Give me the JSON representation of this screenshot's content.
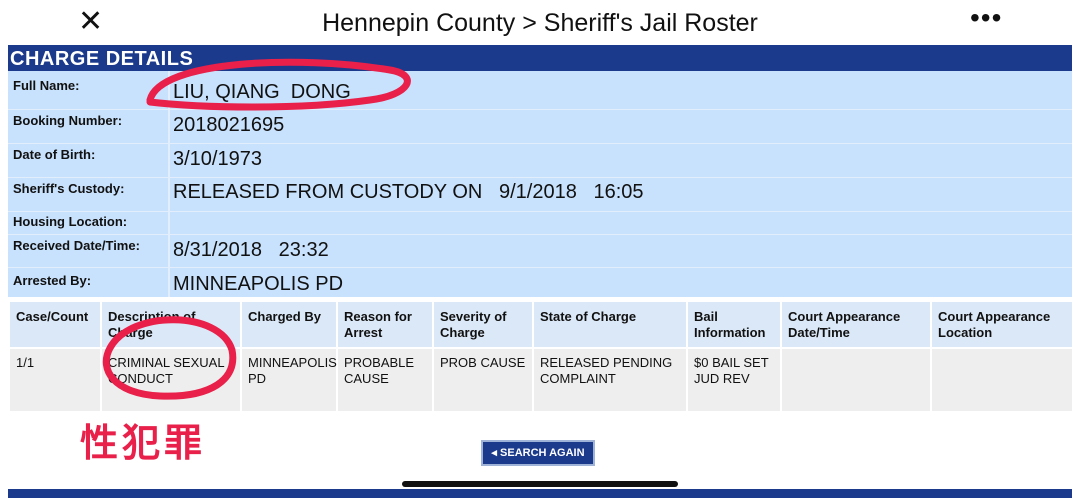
{
  "navbar": {
    "close_icon": "close-icon",
    "title": "Hennepin County > Sheriff's Jail Roster",
    "more_icon": "more-dots-icon",
    "more_glyph": "•••"
  },
  "charge_details": {
    "header": "CHARGE DETAILS",
    "fields": [
      {
        "label": "Full Name:",
        "value": "LIU, QIANG  DONG"
      },
      {
        "label": "Booking Number:",
        "value": "2018021695"
      },
      {
        "label": "Date of Birth:",
        "value": "3/10/1973"
      },
      {
        "label": "Sheriff's Custody:",
        "value": "RELEASED FROM CUSTODY ON   9/1/2018   16:05"
      },
      {
        "label": "Housing Location:",
        "value": ""
      },
      {
        "label": "Received Date/Time:",
        "value": "8/31/2018   23:32"
      },
      {
        "label": "Arrested By:",
        "value": "MINNEAPOLIS PD"
      }
    ]
  },
  "charges_table": {
    "headers": [
      "Case/Count",
      "Description of Charge",
      "Charged By",
      "Reason for Arrest",
      "Severity of Charge",
      "State of Charge",
      "Bail Information",
      "Court Appearance Date/Time",
      "Court Appearance Location"
    ],
    "rows": [
      [
        "1/1",
        "CRIMINAL SEXUAL CONDUCT",
        "MINNEAPOLIS PD",
        "PROBABLE CAUSE",
        "PROB CAUSE",
        "RELEASED PENDING COMPLAINT",
        "$0 BAIL SET JUD REV",
        "",
        ""
      ]
    ]
  },
  "search_again": {
    "label": "SEARCH AGAIN",
    "arrow": "◂"
  },
  "annotation": {
    "text": "性犯罪",
    "color": "#e8204a"
  },
  "colors": {
    "header_blue": "#1b3a8c",
    "panel_blue": "#c8e1fc",
    "annotation_red": "#e8204a"
  }
}
